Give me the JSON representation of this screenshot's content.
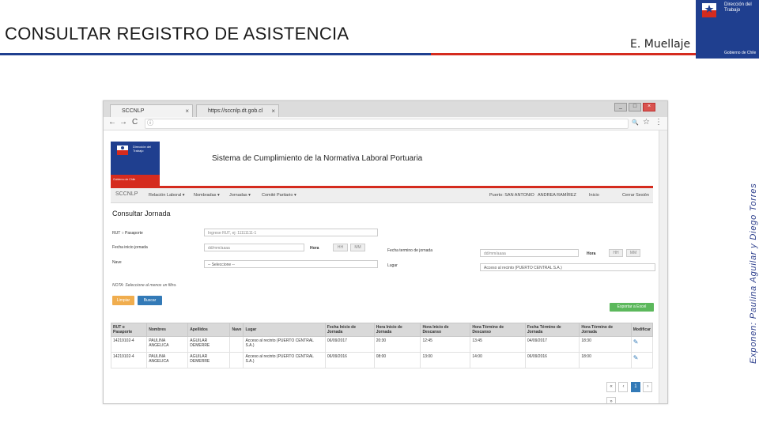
{
  "slide": {
    "title": "CONSULTAR REGISTRO DE ASISTENCIA",
    "presenter_tag": "E. Muellaje",
    "vertical_credit": "Exponen: Paulina Aguilar y Diego Torres",
    "gov_line1": "Dirección del Trabajo",
    "gov_line2": "Gobierno de Chile"
  },
  "browser": {
    "tabs": [
      {
        "label": "SCCNLP"
      },
      {
        "label": "https://sccnlp.dt.gob.cl"
      }
    ],
    "close_glyph": "×",
    "win_buttons": [
      "_",
      "□",
      "×"
    ],
    "nav_icons": {
      "back": "←",
      "forward": "→",
      "reload": "C",
      "info": "ⓘ",
      "search": "🔍",
      "star": "☆",
      "menu": "⋮"
    }
  },
  "app": {
    "logo_text": "Dirección del Trabajo",
    "logo_sub": "Gobierno de Chile",
    "header_title": "Sistema de Cumplimiento de la Normativa Laboral Portuaria",
    "nav": {
      "brand": "SCCNLP",
      "items": [
        "Relación Laboral ▾",
        "Nombradas ▾",
        "Jornadas ▾",
        "Comité Paritario ▾"
      ],
      "port": "Puerto: SAN ANTONIO",
      "user": "ANDREA RAMÍREZ",
      "home": "Inicio",
      "logout": "Cerrar Sesión"
    },
    "page_title": "Consultar Jornada",
    "form": {
      "rut_label": "RUT ○ Pasaporte",
      "rut_placeholder": "Ingrese RUT, ej: 11111111-1",
      "start_label": "Fecha inicio jornada",
      "date_placeholder": "dd/mm/aaaa",
      "hora_label": "Hora",
      "hh": "HH",
      "mm": "MM",
      "end_label": "Fecha termino de jornada",
      "nave_label": "Nave",
      "nave_value": "-- Seleccione --",
      "lugar_label": "Lugar",
      "lugar_value": "Acceso al recinto (PUERTO CENTRAL S.A.)"
    },
    "note": "NOTA: Seleccione al menos un filtro.",
    "buttons": {
      "clear": "Limpiar",
      "search": "Buscar",
      "export": "Exportar a Excel"
    },
    "table": {
      "headers": [
        "RUT o Pasaporte",
        "Nombres",
        "Apellidos",
        "Nave",
        "Lugar",
        "Fecha Inicio de Jornada",
        "Hora Inicio de Jornada",
        "Hora Inicio de Descanso",
        "Hora Término de Descanso",
        "Fecha Término de Jornada",
        "Hora Término de Jornada",
        "Modificar"
      ],
      "rows": [
        [
          "14219102-4",
          "PAULINA ANGELICA",
          "AGUILAR DEMERRE",
          "",
          "Acceso al recinto (PUERTO CENTRAL S.A.)",
          "06/09/2017",
          "20:30",
          "12:45",
          "13:45",
          "04/09/2017",
          "18:30",
          "✎"
        ],
        [
          "14219102-4",
          "PAULINA ANGELICA",
          "AGUILAR DEMERRE",
          "",
          "Acceso al recinto (PUERTO CENTRAL S.A.)",
          "06/09/2016",
          "08:00",
          "13:00",
          "14:00",
          "06/09/2016",
          "18:00",
          "✎"
        ]
      ]
    },
    "pager": [
      "«",
      "‹",
      "1",
      "›",
      "»"
    ]
  }
}
